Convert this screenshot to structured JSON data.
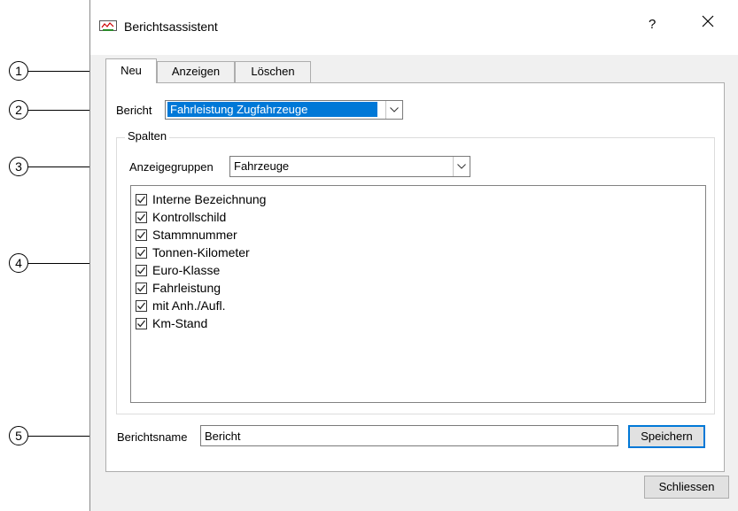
{
  "window": {
    "title": "Berichtsassistent",
    "help_label": "?",
    "close_label": "✕"
  },
  "tabs": [
    {
      "label": "Neu",
      "active": true
    },
    {
      "label": "Anzeigen",
      "active": false
    },
    {
      "label": "Löschen",
      "active": false
    }
  ],
  "report": {
    "label": "Bericht",
    "selected": "Fahrleistung Zugfahrzeuge"
  },
  "columns": {
    "group_title": "Spalten",
    "display_groups_label": "Anzeigegruppen",
    "display_groups_selected": "Fahrzeuge",
    "items": [
      {
        "label": "Interne Bezeichnung",
        "checked": true
      },
      {
        "label": "Kontrollschild",
        "checked": true
      },
      {
        "label": "Stammnummer",
        "checked": true
      },
      {
        "label": "Tonnen-Kilometer",
        "checked": true
      },
      {
        "label": "Euro-Klasse",
        "checked": true
      },
      {
        "label": "Fahrleistung",
        "checked": true
      },
      {
        "label": "mit Anh./Aufl.",
        "checked": true
      },
      {
        "label": "Km-Stand",
        "checked": true
      }
    ]
  },
  "report_name": {
    "label": "Berichtsname",
    "value": "Bericht",
    "save_label": "Speichern"
  },
  "footer": {
    "close_label": "Schliessen"
  },
  "callouts": [
    "1",
    "2",
    "3",
    "4",
    "5"
  ],
  "colors": {
    "accent": "#0078d7",
    "dialog_bg": "#f0f0f0"
  }
}
